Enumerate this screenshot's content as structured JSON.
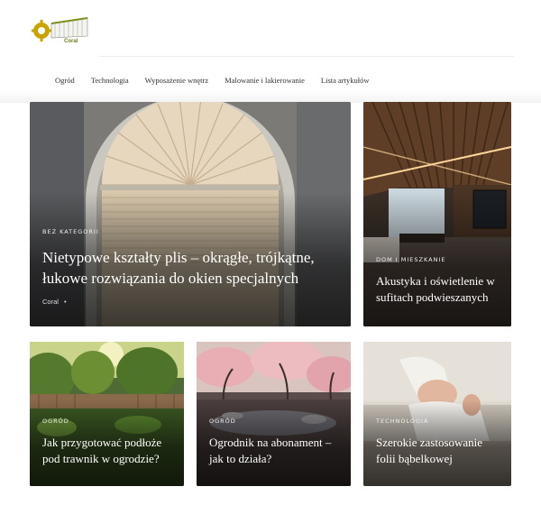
{
  "site": {
    "logo_icon": "gear-building-logo",
    "logo_text": "Coral"
  },
  "nav": {
    "items": [
      {
        "label": "Ogród"
      },
      {
        "label": "Technologia"
      },
      {
        "label": "Wyposażenie wnętrz"
      },
      {
        "label": "Malowanie i lakierowanie"
      },
      {
        "label": "Lista artykułów"
      }
    ]
  },
  "posts": [
    {
      "category": "BEZ KATEGORII",
      "title": "Nietypowe kształty plis – okrągłe, trójkątne, łukowe rozwiązania do okien specjalnych",
      "title_line1": "Nietypowe kształty plis – okrągłe, trójkątne,",
      "title_line2": "łukowe rozwiązania do okien specjalnych",
      "author": "Coral",
      "separator": "•"
    },
    {
      "category": "DOM I MIESZKANIE",
      "title_line1": "Akustyka i oświetlenie w",
      "title_line2": "sufitach podwieszanych"
    },
    {
      "category": "OGRÓD",
      "title_line1": "Jak przygotować podłoże",
      "title_line2": "pod trawnik w ogrodzie?"
    },
    {
      "category": "OGRÓD",
      "title_line1": "Ogrodnik na abonament –",
      "title_line2": "jak to działa?"
    },
    {
      "category": "TECHNOLOGIA",
      "title_line1": "Szerokie zastosowanie",
      "title_line2": "folii bąbelkowej"
    }
  ],
  "colors": {
    "logo_gear": "#c9a400",
    "logo_green": "#7a8f1a",
    "overlay": "#000000"
  }
}
